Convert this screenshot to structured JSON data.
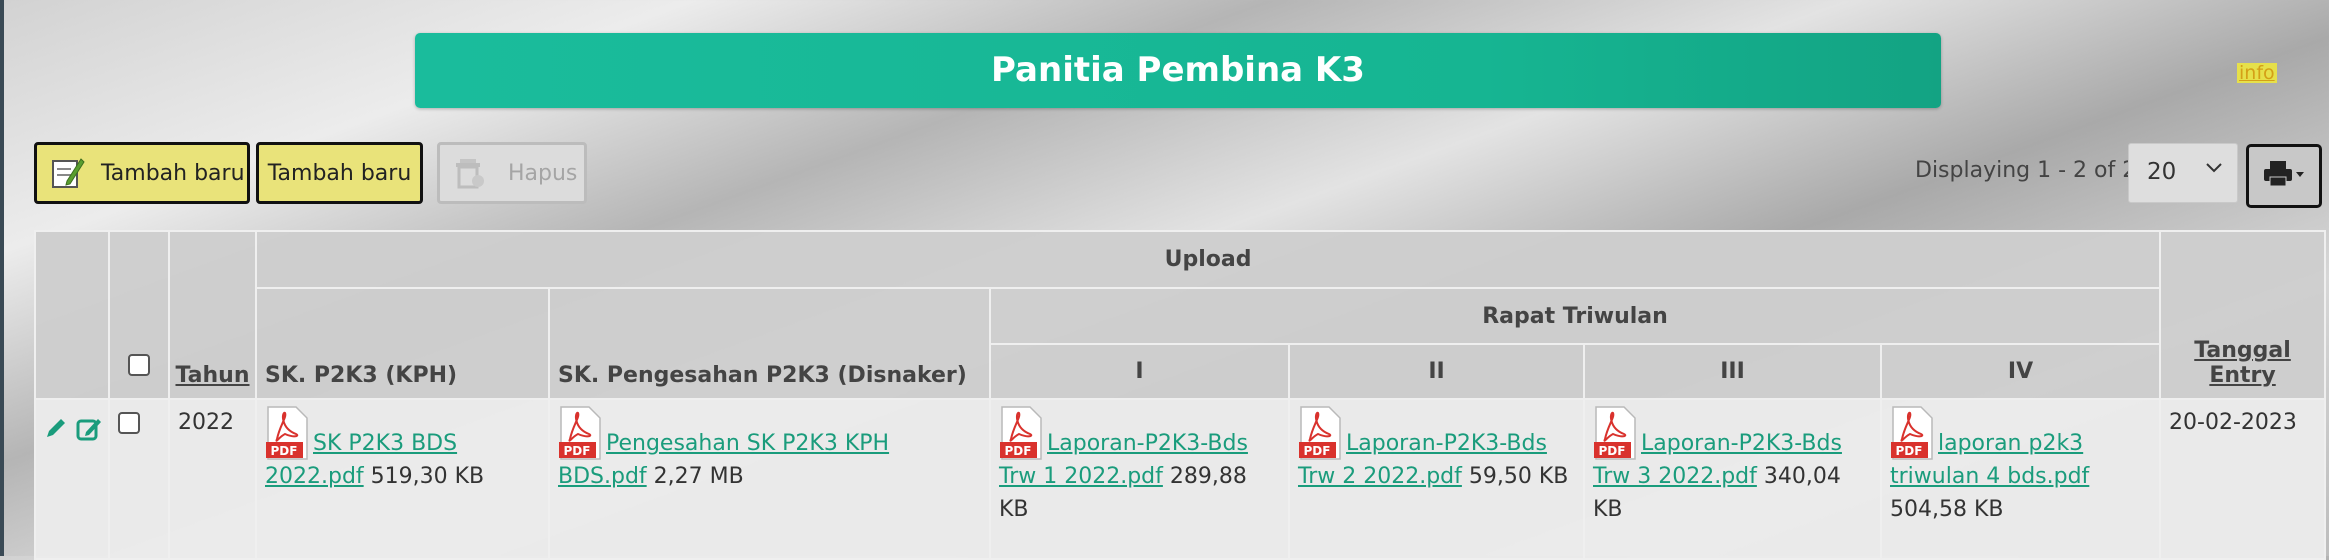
{
  "banner": {
    "title": "Panitia Pembina K3",
    "info": "info"
  },
  "toolbar": {
    "add_label_1": "Tambah baru",
    "add_label_2": "Tambah baru",
    "delete_label": "Hapus",
    "displaying": "Displaying 1 - 2 of 2",
    "page_size": "20"
  },
  "table": {
    "headers": {
      "year": "Tahun",
      "upload": "Upload",
      "sk_p2k3": "SK. P2K3 (KPH)",
      "sk_pengesahan": "SK. Pengesahan P2K3 (Disnaker)",
      "rapat": "Rapat Triwulan",
      "q1": "I",
      "q2": "II",
      "q3": "III",
      "q4": "IV",
      "entry_date": "Tanggal Entry"
    },
    "rows": [
      {
        "year": "2022",
        "sk_p2k3": {
          "name": "SK P2K3 BDS 2022.pdf",
          "size": "519,30 KB"
        },
        "sk_pengesahan": {
          "name": "Pengesahan SK P2K3 KPH BDS.pdf",
          "size": "2,27 MB"
        },
        "q1": {
          "name": "Laporan-P2K3-Bds Trw 1 2022.pdf",
          "size": "289,88 KB"
        },
        "q2": {
          "name": "Laporan-P2K3-Bds Trw 2 2022.pdf",
          "size": "59,50 KB"
        },
        "q3": {
          "name": "Laporan-P2K3-Bds Trw 3 2022.pdf",
          "size": "340,04 KB"
        },
        "q4": {
          "name": "laporan p2k3 triwulan 4 bds.pdf",
          "size": "504,58 KB"
        },
        "entry_date": "20-02-2023"
      }
    ]
  },
  "icons": {
    "file_type": "PDF",
    "edit": "pencil-icon",
    "edit_form": "edit-form-icon",
    "print": "printer-icon",
    "add": "add-note-icon",
    "delete": "trash-icon"
  },
  "colors": {
    "banner": "#1abc9c",
    "link": "#1a9c7c",
    "add_button": "#e9e37a",
    "pdf_red": "#d9322d"
  }
}
